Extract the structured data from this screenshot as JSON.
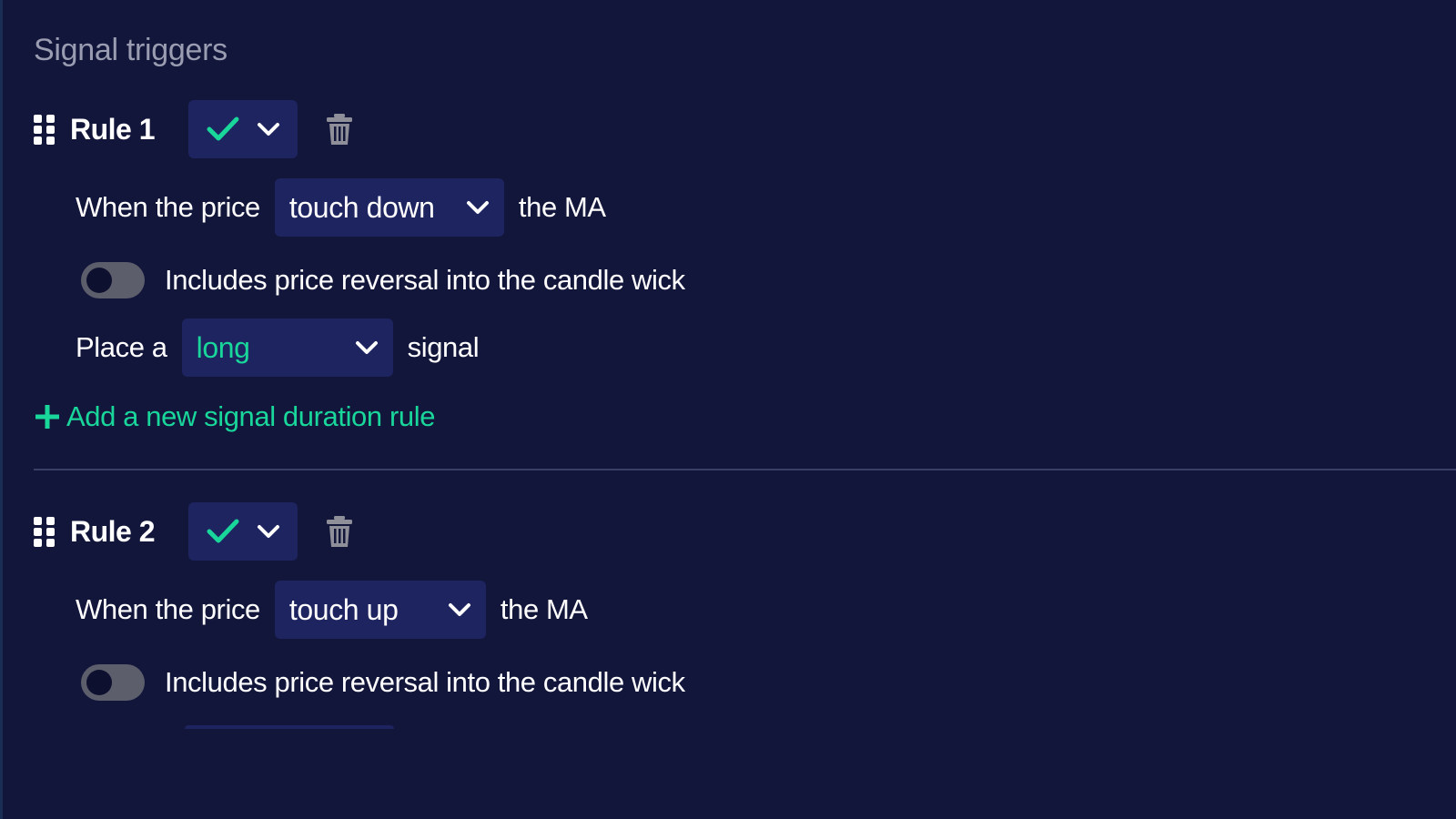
{
  "section": {
    "title": "Signal triggers"
  },
  "rules": [
    {
      "title": "Rule 1",
      "condition_prefix": "When the price",
      "condition_value": "touch down",
      "condition_suffix": "the MA",
      "toggle_label": "Includes price reversal into the candle wick",
      "toggle_on": false,
      "signal_prefix": "Place a",
      "signal_value": "long",
      "signal_suffix": "signal",
      "add_rule_label": "Add a new signal duration rule"
    },
    {
      "title": "Rule 2",
      "condition_prefix": "When the price",
      "condition_value": "touch up",
      "condition_suffix": "the MA",
      "toggle_label": "Includes price reversal into the candle wick",
      "toggle_on": false
    }
  ],
  "colors": {
    "background": "#13163b",
    "select_bg": "#1d2460",
    "accent": "#19d69a",
    "muted_title": "#9a9db1",
    "icon_gray": "#8e8f99"
  },
  "icons": {
    "drag": "drag-handle-icon",
    "check": "check-icon",
    "chevron": "chevron-down-icon",
    "trash": "trash-icon",
    "plus": "plus-icon"
  }
}
